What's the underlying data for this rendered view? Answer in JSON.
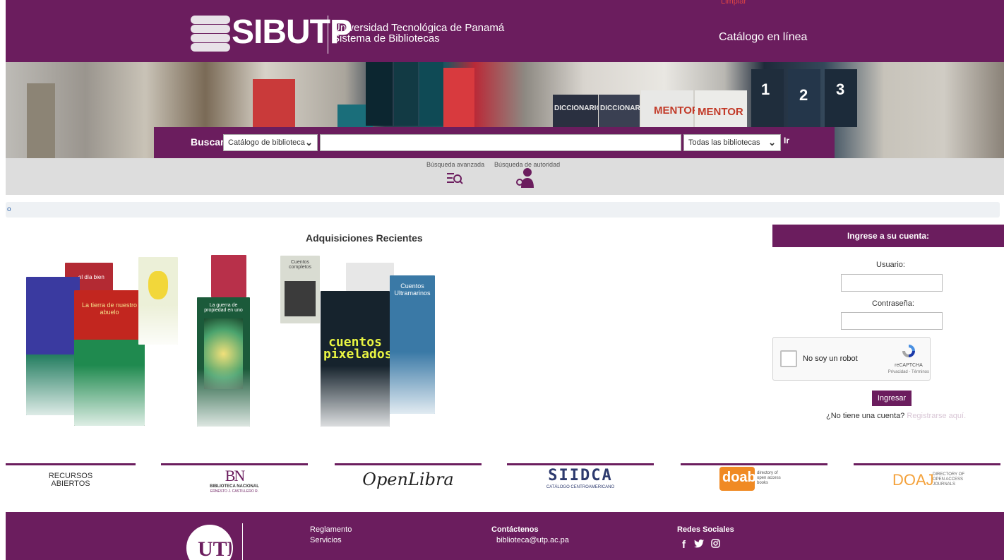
{
  "header": {
    "logo_text": "SIBUTP",
    "university_line1": "Universidad Tecnológica de Panamá",
    "university_line2": "Sistema de Bibliotecas",
    "catalog_title": "Catálogo en línea",
    "clear_link": "Limpiar"
  },
  "banner": {
    "book_labels": [
      "DICCIONARIO",
      "DICCIONARIO",
      "MENTOR",
      "MENTOR",
      "1",
      "2",
      "3"
    ]
  },
  "search": {
    "label": "Buscar",
    "scope_selected": "Catálogo de biblioteca",
    "query_value": "",
    "library_selected": "Todas las bibliotecas",
    "go_label": "Ir"
  },
  "nav": {
    "advanced_search": "Búsqueda avanzada",
    "authority_search": "Búsqueda de autoridad"
  },
  "breadcrumb": {
    "home": "o"
  },
  "recent": {
    "title": "Adquisiciones Recientes",
    "covers": [
      {
        "text": "...el día bien"
      },
      {
        "text": "La tierra de nuestro abuelo"
      },
      {
        "text": ""
      },
      {
        "text": "La guerra de propiedad en uno"
      },
      {
        "text": "Cuentos completos"
      },
      {
        "text": "Cuentos Ultramarinos"
      },
      {
        "text": "cuentos pixelados"
      }
    ]
  },
  "login": {
    "heading": "Ingrese a su cuenta:",
    "username_label": "Usuario:",
    "password_label": "Contraseña:",
    "username_value": "",
    "password_value": "",
    "captcha_label": "No soy un robot",
    "captcha_brand": "reCAPTCHA",
    "captcha_terms": "Privacidad - Términos",
    "submit_label": "Ingresar",
    "register_prompt": "¿No tiene una cuenta?",
    "register_link": "Registrarse aquí."
  },
  "partners": {
    "resources": "RECURSOS ABIERTOS",
    "bn_mark": "BN",
    "bn_name": "BIBLIOTECA NACIONAL",
    "bn_sub": "ERNESTO J. CASTILLERO R.",
    "openlibra": "OpenLibra",
    "siidca": "SIIDCA",
    "siidca_sub": "CATÁLOGO CENTROAMERICANO",
    "doab": "doab",
    "doab_sub": "directory of open access books",
    "doaj": "DOAJ",
    "doaj_sub": "DIRECTORY OF OPEN ACCESS JOURNALS"
  },
  "footer": {
    "links": [
      "Reglamento",
      "Servicios"
    ],
    "contact_head": "Contáctenos",
    "contact_email": "biblioteca@utp.ac.pa",
    "social_head": "Redes Sociales",
    "seal_text": "UTP"
  },
  "colors": {
    "brand": "#6b1d5e",
    "gray_bar": "#dddddd",
    "breadcrumb_bg": "#eef1f4"
  }
}
